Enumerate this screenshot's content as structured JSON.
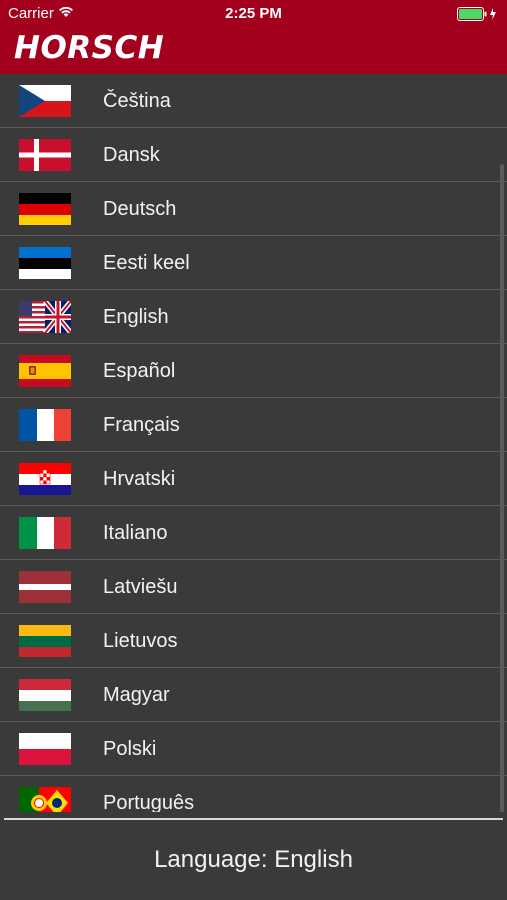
{
  "status_bar": {
    "carrier": "Carrier",
    "time": "2:25 PM",
    "wifi_icon": "wifi-icon",
    "battery_icon": "battery-charging-icon",
    "battery_color": "#4cd964"
  },
  "header": {
    "logo_text": "HORSCH",
    "background_color": "#a3001e"
  },
  "languages": [
    {
      "label": "Čeština",
      "flag": "cz"
    },
    {
      "label": "Dansk",
      "flag": "dk"
    },
    {
      "label": "Deutsch",
      "flag": "de"
    },
    {
      "label": "Eesti keel",
      "flag": "ee"
    },
    {
      "label": "English",
      "flag": "us-gb"
    },
    {
      "label": "Español",
      "flag": "es"
    },
    {
      "label": "Français",
      "flag": "fr"
    },
    {
      "label": "Hrvatski",
      "flag": "hr"
    },
    {
      "label": "Italiano",
      "flag": "it"
    },
    {
      "label": "Latviešu",
      "flag": "lv"
    },
    {
      "label": "Lietuvos",
      "flag": "lt"
    },
    {
      "label": "Magyar",
      "flag": "hu"
    },
    {
      "label": "Polski",
      "flag": "pl"
    },
    {
      "label": "Português",
      "flag": "pt-br"
    }
  ],
  "footer": {
    "language_text": "Language: English"
  }
}
